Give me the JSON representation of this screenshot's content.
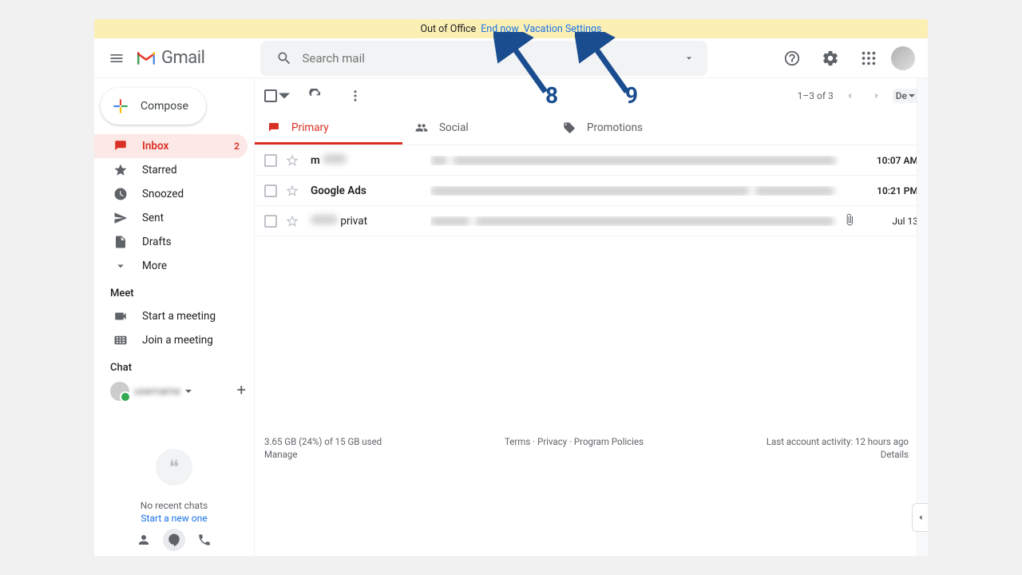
{
  "banner": {
    "label": "Out of Office",
    "end_now": "End now",
    "vacation": "Vacation Settings"
  },
  "header": {
    "product": "Gmail",
    "search_placeholder": "Search mail"
  },
  "compose": {
    "label": "Compose"
  },
  "nav": {
    "inbox": "Inbox",
    "inbox_count": "2",
    "starred": "Starred",
    "snoozed": "Snoozed",
    "sent": "Sent",
    "drafts": "Drafts",
    "more": "More"
  },
  "meet": {
    "title": "Meet",
    "start": "Start a meeting",
    "join": "Join a meeting"
  },
  "chat": {
    "title": "Chat",
    "username": "username",
    "no_recent": "No recent chats",
    "start_new": "Start a new one"
  },
  "toolbar": {
    "range": "1–3 of 3",
    "lang": "De"
  },
  "tabs": {
    "primary": "Primary",
    "social": "Social",
    "promotions": "Promotions"
  },
  "emails": [
    {
      "sender_prefix": "m",
      "date": "10:07 AM",
      "unread": true
    },
    {
      "sender": "Google Ads",
      "date": "10:21 PM",
      "unread": true
    },
    {
      "sender_suffix": "privat",
      "date": "Jul 13",
      "unread": false,
      "attachment": true
    }
  ],
  "footer": {
    "storage": "3.65 GB (24%) of 15 GB used",
    "manage": "Manage",
    "terms": "Terms",
    "privacy": "Privacy",
    "policies": "Program Policies",
    "activity": "Last account activity: 12 hours ago",
    "details": "Details"
  },
  "annotations": {
    "eight": "8",
    "nine": "9"
  }
}
